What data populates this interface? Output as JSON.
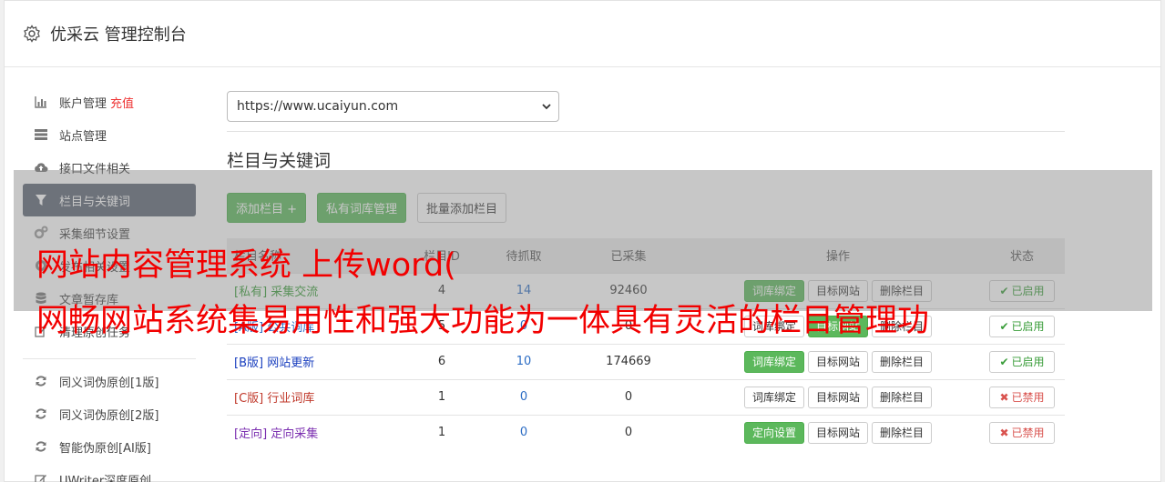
{
  "header": {
    "title": "优采云 管理控制台",
    "icon": "gear-icon"
  },
  "sidebar": {
    "items": [
      {
        "label": "账户管理",
        "extra": "充值",
        "icon": "bar-chart-icon"
      },
      {
        "label": "站点管理",
        "icon": "server-list-icon"
      },
      {
        "label": "接口文件相关",
        "icon": "cloud-upload-icon"
      },
      {
        "label": "栏目与关键词",
        "icon": "filter-icon",
        "active": true
      },
      {
        "label": "采集细节设置",
        "icon": "cogs-icon"
      },
      {
        "label": "发布相关设置",
        "icon": "target-icon"
      },
      {
        "label": "文章暂存库",
        "icon": "database-icon"
      },
      {
        "label": "清理原创任务",
        "icon": "edit-icon"
      }
    ],
    "items2": [
      {
        "label": "同义词伪原创[1版]",
        "icon": "refresh-icon"
      },
      {
        "label": "同义词伪原创[2版]",
        "icon": "refresh-icon"
      },
      {
        "label": "智能伪原创[AI版]",
        "icon": "refresh-icon"
      },
      {
        "label": "UWriter深度原创",
        "icon": "edit-icon"
      }
    ]
  },
  "main": {
    "site_select": {
      "value": "https://www.ucaiyun.com"
    },
    "section_title": "栏目与关键词",
    "buttons": {
      "add_column": "添加栏目 +",
      "private_lib": "私有词库管理",
      "batch_add": "批量添加栏目"
    },
    "table": {
      "headers": [
        "栏目名称",
        "栏目ID",
        "待抓取",
        "已采集",
        "操作",
        "状态"
      ],
      "rows": [
        {
          "tag": "[私有]",
          "name": "采集交流",
          "id": "4",
          "pending": "14",
          "collected": "92460",
          "op1": "词库绑定",
          "op2": "目标网站",
          "op3": "删除栏目",
          "status": "已启用"
        },
        {
          "tag": "[A版]",
          "name": "公共词库",
          "id": "5",
          "pending": "0",
          "collected": "0",
          "op1": "词库绑定",
          "op2": "目标网站",
          "op3": "删除栏目",
          "status": "已启用"
        },
        {
          "tag": "[B版]",
          "name": "网站更新",
          "id": "6",
          "pending": "10",
          "collected": "174669",
          "op1": "词库绑定",
          "op2": "目标网站",
          "op3": "删除栏目",
          "status": "已启用"
        },
        {
          "tag": "[C版]",
          "name": "行业词库",
          "id": "1",
          "pending": "0",
          "collected": "0",
          "op1": "词库绑定",
          "op2": "目标网站",
          "op3": "删除栏目",
          "status": "已禁用"
        },
        {
          "tag": "[定向]",
          "name": "定向采集",
          "id": "1",
          "pending": "0",
          "collected": "0",
          "op1": "定向设置",
          "op2": "目标网站",
          "op3": "删除栏目",
          "status": "已禁用"
        }
      ]
    }
  },
  "overlay": {
    "line1": "网站内容管理系统 上传word(",
    "line2": "网畅网站系统集易用性和强大功能为一体具有灵活的栏目管理功"
  },
  "colors": {
    "active_bg": "#5b6473",
    "green": "#5cb85c",
    "overlay_red": "#f20000"
  }
}
